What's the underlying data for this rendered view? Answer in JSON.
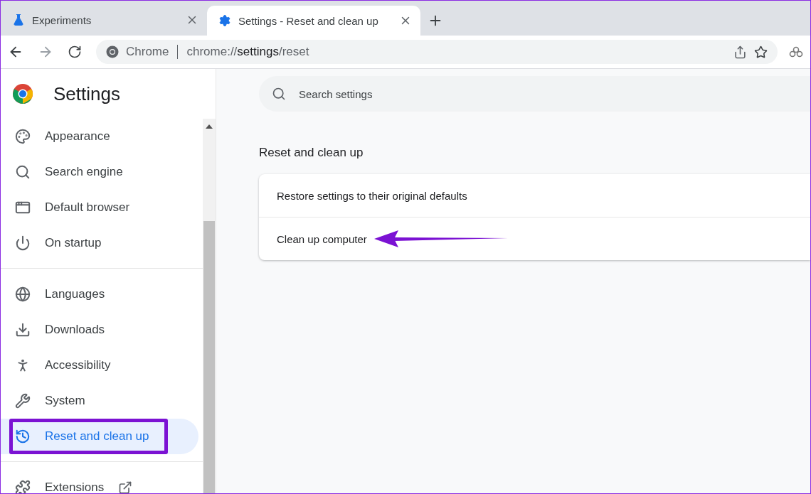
{
  "tabs": [
    {
      "title": "Experiments",
      "selected": false
    },
    {
      "title": "Settings - Reset and clean up",
      "selected": true
    }
  ],
  "address": {
    "origin": "Chrome",
    "url_prefix": "chrome://",
    "url_host": "settings",
    "url_path": "/reset"
  },
  "sidebar": {
    "title": "Settings",
    "groups": [
      [
        {
          "label": "Appearance",
          "selected": false,
          "highlighted": false,
          "external": false
        },
        {
          "label": "Search engine",
          "selected": false,
          "highlighted": false,
          "external": false
        },
        {
          "label": "Default browser",
          "selected": false,
          "highlighted": false,
          "external": false
        },
        {
          "label": "On startup",
          "selected": false,
          "highlighted": false,
          "external": false
        }
      ],
      [
        {
          "label": "Languages",
          "selected": false,
          "highlighted": false,
          "external": false
        },
        {
          "label": "Downloads",
          "selected": false,
          "highlighted": false,
          "external": false
        },
        {
          "label": "Accessibility",
          "selected": false,
          "highlighted": false,
          "external": false
        },
        {
          "label": "System",
          "selected": false,
          "highlighted": false,
          "external": false
        },
        {
          "label": "Reset and clean up",
          "selected": true,
          "highlighted": true,
          "external": false
        }
      ],
      [
        {
          "label": "Extensions",
          "selected": false,
          "highlighted": false,
          "external": true
        }
      ]
    ]
  },
  "search": {
    "placeholder": "Search settings"
  },
  "section": {
    "title": "Reset and clean up",
    "rows": [
      {
        "label": "Restore settings to their original defaults",
        "pointed": false
      },
      {
        "label": "Clean up computer",
        "pointed": true
      }
    ]
  }
}
